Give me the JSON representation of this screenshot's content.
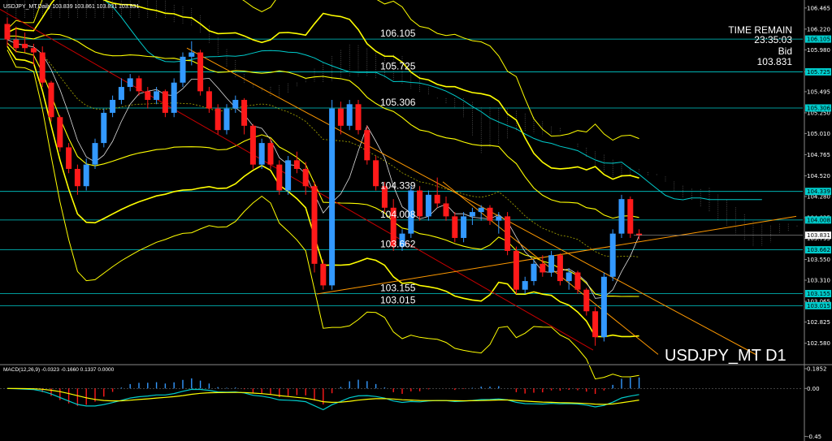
{
  "header_text": "USDJPY_MT,Daily  103.839 103.861 103.831 103.831",
  "watermark": "USDJPY_MT D1",
  "info": {
    "time_remain_label": "TIME REMAIN",
    "time_remain": "23:35:03",
    "bid_label": "Bid",
    "bid": "103.831"
  },
  "colors": {
    "background": "#000000",
    "bull": "#3399ff",
    "bear": "#ff1a1a",
    "bollinger": "#ffff00",
    "level_line": "#00cccc",
    "trend_red": "#cc0000",
    "trend_orange": "#ff9900",
    "ichimoku_kijun": "#00cccc",
    "macd_signal": "#ffff00",
    "macd_main": "#00cccc"
  },
  "chart_data": [
    {
      "type": "candlestick",
      "panel": "price",
      "ylim": [
        102.35,
        106.52
      ],
      "y_ticks": [
        "106.465",
        "106.220",
        "105.980",
        "105.725",
        "105.495",
        "105.250",
        "105.010",
        "104.765",
        "104.520",
        "104.280",
        "104.035",
        "103.795",
        "103.550",
        "103.310",
        "103.065",
        "102.825",
        "102.580"
      ],
      "levels": [
        {
          "value": 106.105,
          "label": "106.105"
        },
        {
          "value": 105.725,
          "label": "105.725"
        },
        {
          "value": 105.306,
          "label": "105.306"
        },
        {
          "value": 104.339,
          "label": "104.339"
        },
        {
          "value": 104.008,
          "label": "104.008"
        },
        {
          "value": 103.662,
          "label": "103.662"
        },
        {
          "value": 103.155,
          "label": "103.155"
        },
        {
          "value": 103.015,
          "label": "103.015"
        }
      ],
      "current_price": "103.831",
      "axis_tags": [
        "106.105",
        "105.725",
        "105.306",
        "104.339",
        "104.008",
        "103.831",
        "103.662",
        "103.155",
        "103.015"
      ],
      "candles": [
        [
          106.28,
          106.35,
          106.02,
          106.1
        ],
        [
          106.1,
          106.25,
          105.95,
          106.0
        ],
        [
          106.05,
          106.18,
          105.95,
          106.0
        ],
        [
          106.0,
          106.05,
          105.8,
          105.95
        ],
        [
          105.95,
          106.02,
          105.55,
          105.6
        ],
        [
          105.6,
          105.62,
          105.15,
          105.2
        ],
        [
          105.2,
          105.22,
          104.8,
          104.85
        ],
        [
          104.85,
          104.9,
          104.55,
          104.6
        ],
        [
          104.6,
          104.65,
          104.3,
          104.4
        ],
        [
          104.4,
          104.72,
          104.35,
          104.65
        ],
        [
          104.65,
          104.95,
          104.6,
          104.9
        ],
        [
          104.9,
          105.3,
          104.85,
          105.25
        ],
        [
          105.25,
          105.45,
          105.2,
          105.4
        ],
        [
          105.4,
          105.65,
          105.35,
          105.55
        ],
        [
          105.55,
          105.7,
          105.5,
          105.65
        ],
        [
          105.65,
          105.68,
          105.45,
          105.5
        ],
        [
          105.5,
          105.55,
          105.3,
          105.4
        ],
        [
          105.4,
          105.55,
          105.35,
          105.5
        ],
        [
          105.5,
          105.52,
          105.2,
          105.25
        ],
        [
          105.25,
          105.65,
          105.2,
          105.6
        ],
        [
          105.6,
          105.95,
          105.55,
          105.9
        ],
        [
          105.9,
          106.08,
          105.8,
          105.95
        ],
        [
          105.95,
          105.98,
          105.45,
          105.5
        ],
        [
          105.5,
          105.55,
          105.25,
          105.3
        ],
        [
          105.3,
          105.35,
          105.0,
          105.05
        ],
        [
          105.05,
          105.35,
          105.0,
          105.3
        ],
        [
          105.3,
          105.45,
          105.25,
          105.4
        ],
        [
          105.4,
          105.42,
          105.0,
          105.1
        ],
        [
          105.1,
          105.12,
          104.6,
          104.65
        ],
        [
          104.65,
          104.95,
          104.6,
          104.9
        ],
        [
          104.9,
          104.95,
          104.6,
          104.65
        ],
        [
          104.65,
          104.7,
          104.3,
          104.35
        ],
        [
          104.35,
          104.75,
          104.3,
          104.7
        ],
        [
          104.7,
          104.8,
          104.55,
          104.6
        ],
        [
          104.6,
          104.68,
          104.3,
          104.4
        ],
        [
          104.4,
          104.45,
          103.4,
          103.5
        ],
        [
          103.5,
          103.55,
          103.2,
          103.25
        ],
        [
          103.25,
          105.4,
          103.2,
          105.3
        ],
        [
          105.3,
          105.38,
          105.0,
          105.1
        ],
        [
          105.1,
          105.4,
          105.05,
          105.35
        ],
        [
          105.35,
          105.4,
          105.0,
          105.05
        ],
        [
          105.05,
          105.1,
          104.65,
          104.7
        ],
        [
          104.7,
          104.75,
          104.35,
          104.4
        ],
        [
          104.4,
          104.45,
          104.1,
          104.15
        ],
        [
          104.15,
          104.25,
          103.65,
          103.7
        ],
        [
          103.7,
          103.9,
          103.65,
          103.85
        ],
        [
          103.85,
          104.4,
          103.8,
          104.35
        ],
        [
          104.35,
          104.4,
          104.0,
          104.05
        ],
        [
          104.05,
          104.35,
          104.0,
          104.3
        ],
        [
          104.3,
          104.5,
          104.15,
          104.2
        ],
        [
          104.2,
          104.28,
          104.0,
          104.05
        ],
        [
          104.05,
          104.1,
          103.75,
          103.8
        ],
        [
          103.8,
          104.1,
          103.75,
          104.05
        ],
        [
          104.05,
          104.15,
          103.95,
          104.1
        ],
        [
          104.1,
          104.18,
          104.0,
          104.15
        ],
        [
          104.15,
          104.18,
          103.95,
          104.0
        ],
        [
          104.0,
          104.1,
          103.85,
          104.05
        ],
        [
          104.05,
          104.1,
          103.6,
          103.65
        ],
        [
          103.65,
          103.7,
          103.15,
          103.2
        ],
        [
          103.2,
          103.35,
          103.15,
          103.3
        ],
        [
          103.3,
          103.55,
          103.25,
          103.5
        ],
        [
          103.5,
          103.6,
          103.35,
          103.4
        ],
        [
          103.4,
          103.65,
          103.35,
          103.6
        ],
        [
          103.6,
          103.62,
          103.25,
          103.3
        ],
        [
          103.3,
          103.45,
          103.2,
          103.4
        ],
        [
          103.4,
          103.42,
          103.15,
          103.2
        ],
        [
          103.2,
          103.22,
          102.9,
          102.95
        ],
        [
          102.95,
          103.0,
          102.55,
          102.65
        ],
        [
          102.65,
          103.4,
          102.6,
          103.35
        ],
        [
          103.35,
          103.9,
          103.3,
          103.85
        ],
        [
          103.85,
          104.3,
          103.8,
          104.25
        ],
        [
          104.25,
          104.28,
          103.8,
          103.85
        ],
        [
          103.85,
          103.9,
          103.78,
          103.83
        ]
      ]
    },
    {
      "type": "histogram_line",
      "panel": "indicator",
      "title": "MACD(12,26,9) -0.0323 -0.1660 0.1337 0.0000",
      "ylim": [
        -0.47,
        0.2
      ],
      "y_ticks": [
        "0.1852",
        "0.00",
        "-0.45"
      ]
    }
  ]
}
